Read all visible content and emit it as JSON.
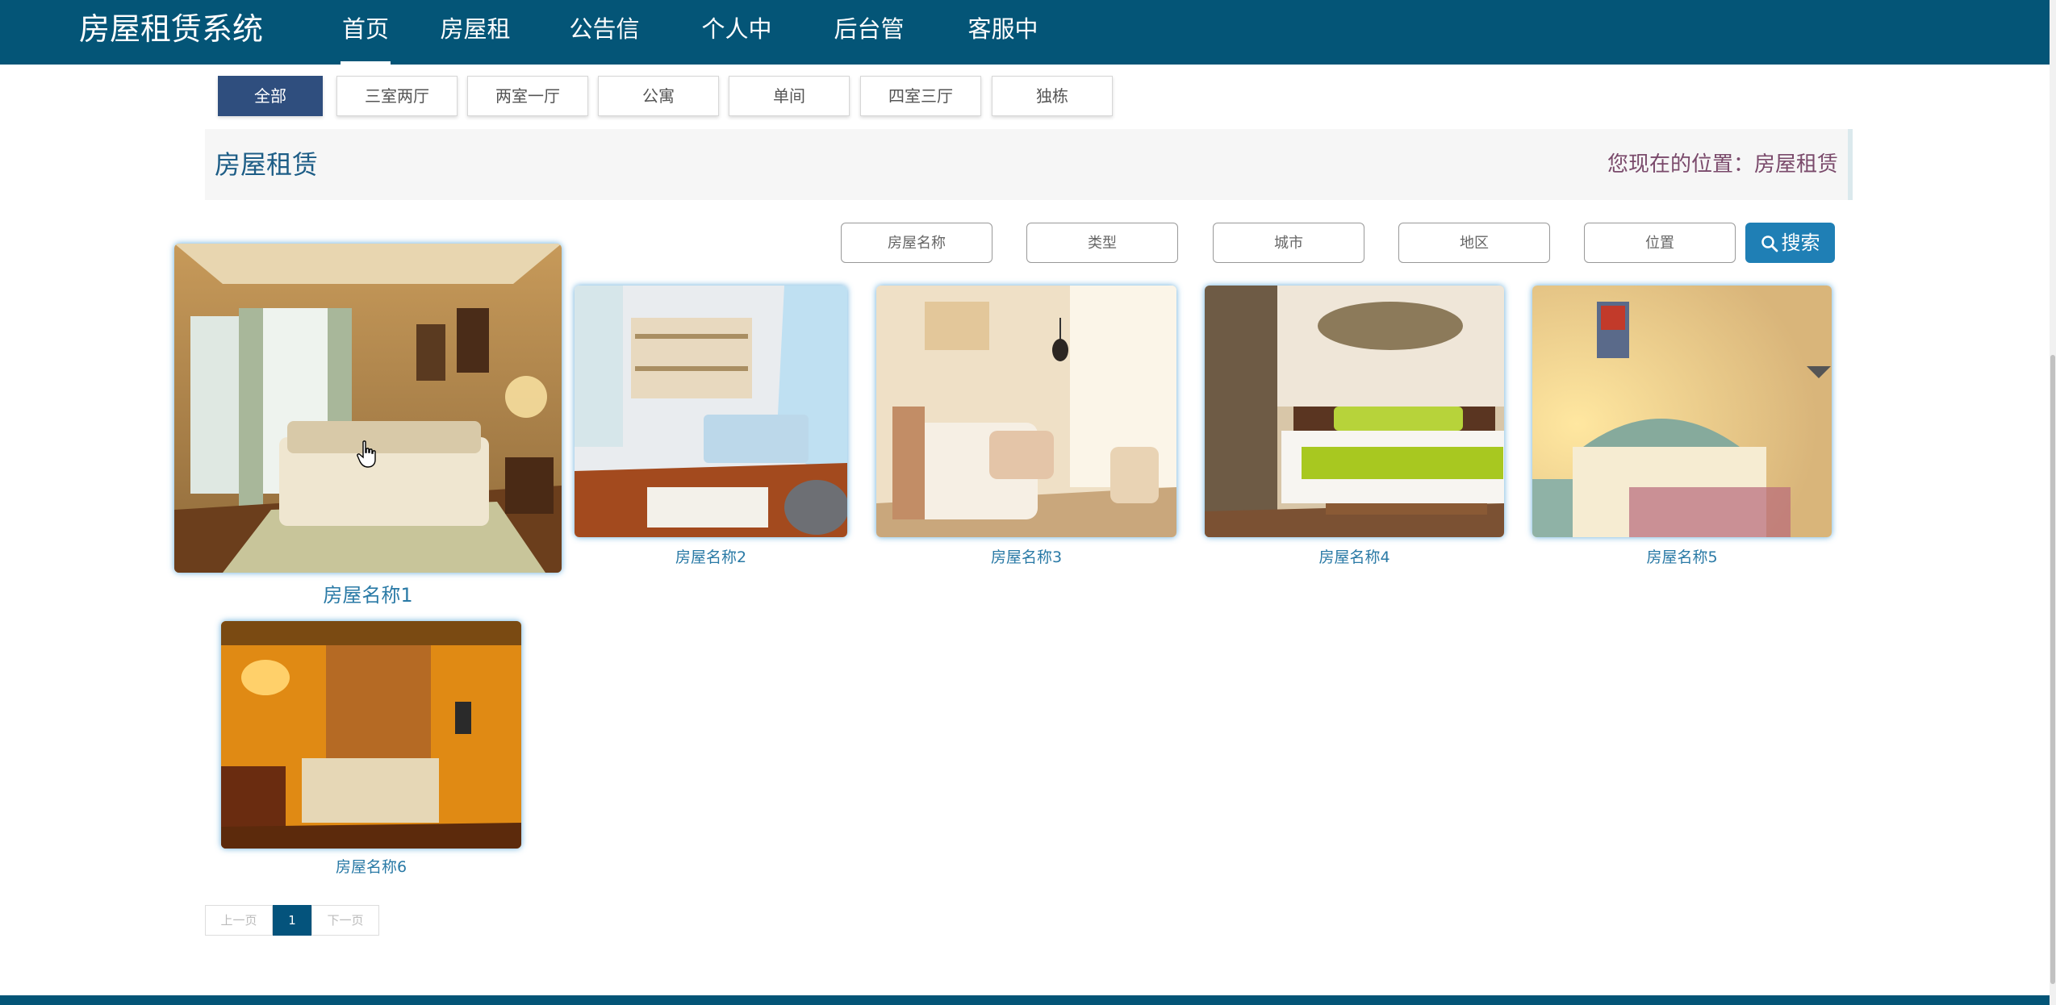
{
  "header": {
    "brand": "房屋租赁系统",
    "nav": [
      "首页",
      "房屋租赁",
      "公告信息",
      "个人中心",
      "后台管理",
      "客服中心"
    ],
    "active_nav": "首页"
  },
  "categories": [
    "全部",
    "三室两厅",
    "两室一厅",
    "公寓",
    "单间",
    "四室三厅",
    "独栋"
  ],
  "active_category": "全部",
  "section": {
    "title": "房屋租赁",
    "breadcrumb_label": "您现在的位置：",
    "breadcrumb_value": "房屋租赁"
  },
  "search": {
    "placeholders": [
      "房屋名称",
      "类型",
      "城市",
      "地区",
      "位置"
    ],
    "button_label": "搜索"
  },
  "houses": [
    {
      "name": "房屋名称1"
    },
    {
      "name": "房屋名称2"
    },
    {
      "name": "房屋名称3"
    },
    {
      "name": "房屋名称4"
    },
    {
      "name": "房屋名称5"
    },
    {
      "name": "房屋名称6"
    }
  ],
  "pagination": {
    "prev": "上一页",
    "current": "1",
    "next": "下一页"
  },
  "colors": {
    "primary": "#045577",
    "active_tab": "#2f4e7e",
    "search_button": "#1f7fb5",
    "link": "#2a7aa6"
  }
}
